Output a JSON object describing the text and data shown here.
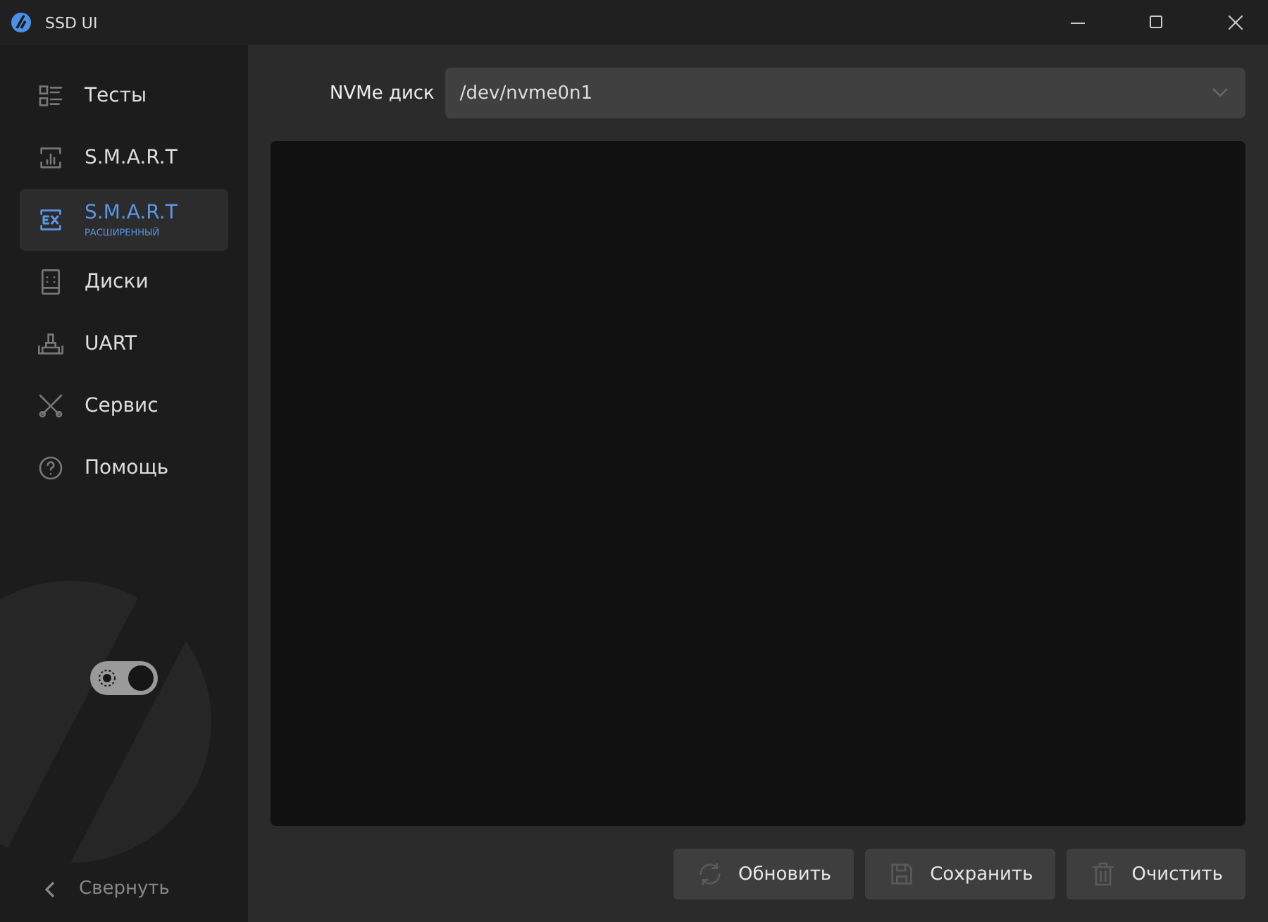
{
  "window": {
    "title": "SSD UI"
  },
  "sidebar": {
    "items": [
      {
        "label": "Тесты",
        "selected": false
      },
      {
        "label": "S.M.A.R.T",
        "selected": false
      },
      {
        "label": "S.M.A.R.T",
        "sublabel": "РАСШИРЕННЫЙ",
        "selected": true
      },
      {
        "label": "Диски",
        "selected": false
      },
      {
        "label": "UART",
        "selected": false
      },
      {
        "label": "Сервис",
        "selected": false
      },
      {
        "label": "Помощь",
        "selected": false
      }
    ],
    "theme_toggle": {
      "on": true
    },
    "collapse": "Свернуть"
  },
  "disk_select": {
    "label": "NVMe диск",
    "value": "/dev/nvme0n1"
  },
  "buttons": [
    "Обновить",
    "Сохранить",
    "Очистить"
  ]
}
